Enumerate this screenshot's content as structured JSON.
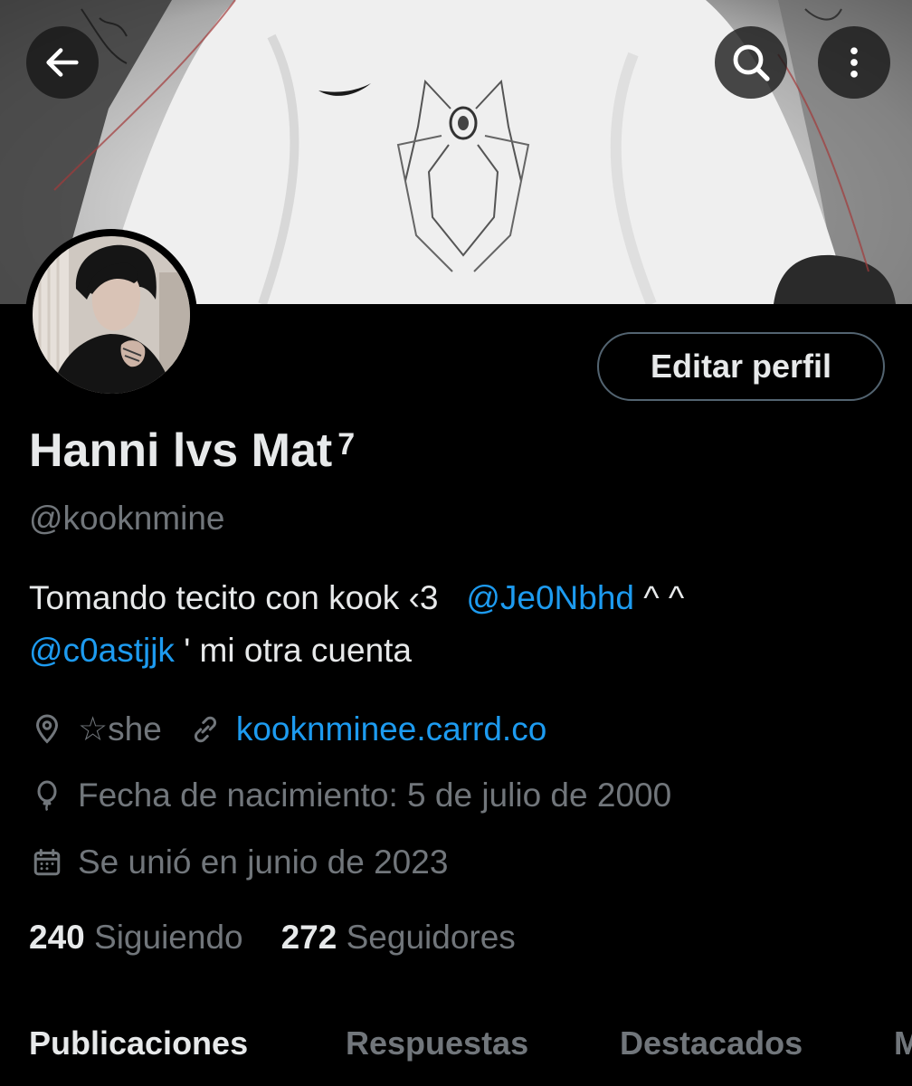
{
  "header": {
    "back_icon": "arrow-left-icon",
    "search_icon": "search-icon",
    "more_icon": "more-vertical-icon"
  },
  "profile": {
    "edit_button_label": "Editar perfil",
    "display_name": "Hanni lvs Mat",
    "display_name_superscript": "7",
    "handle": "@kooknmine",
    "bio": {
      "line1_text": "Tomando tecito con kook ‹3",
      "line1_mention": "@Je0Nbhd",
      "line1_suffix": " ^ ^",
      "line2_mention": "@c0astjjk",
      "line2_text": " ' mi otra cuenta"
    },
    "location": "☆she",
    "website": "kooknminee.carrd.co",
    "birthday": "Fecha de nacimiento: 5 de julio de 2000",
    "joined": "Se unió en junio de 2023"
  },
  "stats": {
    "following_count": "240",
    "following_label": "Siguiendo",
    "followers_count": "272",
    "followers_label": "Seguidores"
  },
  "tabs": [
    {
      "label": "Publicaciones",
      "active": true
    },
    {
      "label": "Respuestas",
      "active": false
    },
    {
      "label": "Destacados",
      "active": false
    },
    {
      "label": "M",
      "active": false
    }
  ],
  "colors": {
    "background": "#000000",
    "text_primary": "#e7e9ea",
    "text_secondary": "#71767b",
    "accent": "#1d9bf0",
    "border": "#536471"
  }
}
